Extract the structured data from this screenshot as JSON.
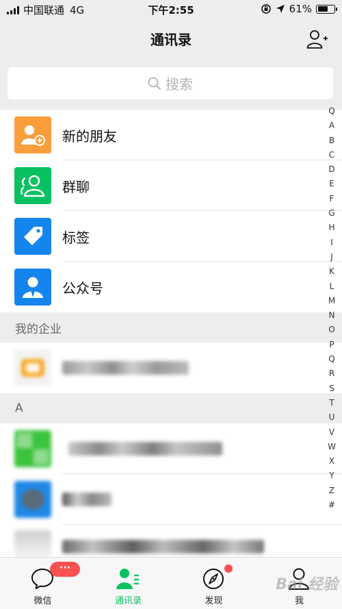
{
  "status_bar": {
    "carrier": "中国联通",
    "network": "4G",
    "time": "下午2:55",
    "battery_percent": "61%",
    "battery_level": 0.61
  },
  "header": {
    "title": "通讯录",
    "add_icon": "add-contact-icon"
  },
  "search": {
    "placeholder": "搜索",
    "icon": "search-icon"
  },
  "functions": [
    {
      "label": "新的朋友",
      "icon": "new-friend-icon",
      "color": "#fa9d3b"
    },
    {
      "label": "群聊",
      "icon": "group-chat-icon",
      "color": "#07c160"
    },
    {
      "label": "标签",
      "icon": "tag-icon",
      "color": "#1485ee"
    },
    {
      "label": "公众号",
      "icon": "official-account-icon",
      "color": "#1485ee"
    }
  ],
  "sections": {
    "enterprise": "我的企业",
    "a": "A"
  },
  "index": [
    "Q",
    "A",
    "B",
    "C",
    "D",
    "E",
    "F",
    "G",
    "H",
    "I",
    "J",
    "K",
    "L",
    "M",
    "N",
    "O",
    "P",
    "Q",
    "R",
    "S",
    "T",
    "U",
    "V",
    "W",
    "X",
    "Y",
    "Z",
    "#"
  ],
  "tabs": [
    {
      "label": "微信",
      "icon": "chat-bubble-icon"
    },
    {
      "label": "通讯录",
      "icon": "contacts-icon",
      "active": true
    },
    {
      "label": "发现",
      "icon": "compass-icon"
    },
    {
      "label": "我",
      "icon": "person-icon"
    }
  ],
  "badge": "···",
  "watermark": "Bai 经验",
  "colors": {
    "accent": "#07c160",
    "badge": "#fa5151",
    "background": "#ededed"
  }
}
